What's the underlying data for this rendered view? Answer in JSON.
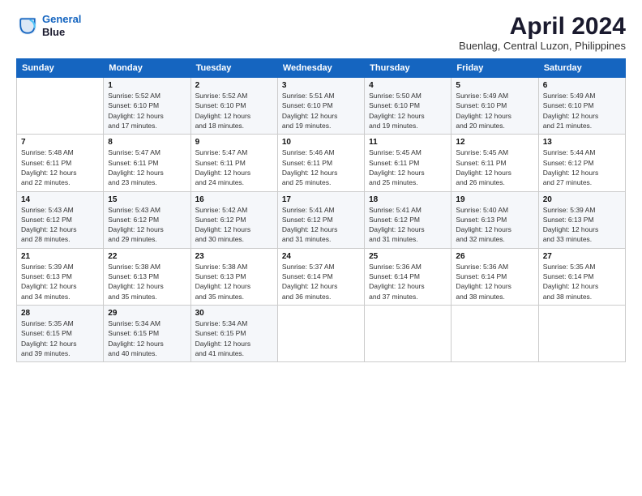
{
  "logo": {
    "line1": "General",
    "line2": "Blue"
  },
  "title": "April 2024",
  "subtitle": "Buenlag, Central Luzon, Philippines",
  "weekdays": [
    "Sunday",
    "Monday",
    "Tuesday",
    "Wednesday",
    "Thursday",
    "Friday",
    "Saturday"
  ],
  "weeks": [
    [
      {
        "day": "",
        "info": ""
      },
      {
        "day": "1",
        "info": "Sunrise: 5:52 AM\nSunset: 6:10 PM\nDaylight: 12 hours\nand 17 minutes."
      },
      {
        "day": "2",
        "info": "Sunrise: 5:52 AM\nSunset: 6:10 PM\nDaylight: 12 hours\nand 18 minutes."
      },
      {
        "day": "3",
        "info": "Sunrise: 5:51 AM\nSunset: 6:10 PM\nDaylight: 12 hours\nand 19 minutes."
      },
      {
        "day": "4",
        "info": "Sunrise: 5:50 AM\nSunset: 6:10 PM\nDaylight: 12 hours\nand 19 minutes."
      },
      {
        "day": "5",
        "info": "Sunrise: 5:49 AM\nSunset: 6:10 PM\nDaylight: 12 hours\nand 20 minutes."
      },
      {
        "day": "6",
        "info": "Sunrise: 5:49 AM\nSunset: 6:10 PM\nDaylight: 12 hours\nand 21 minutes."
      }
    ],
    [
      {
        "day": "7",
        "info": "Sunrise: 5:48 AM\nSunset: 6:11 PM\nDaylight: 12 hours\nand 22 minutes."
      },
      {
        "day": "8",
        "info": "Sunrise: 5:47 AM\nSunset: 6:11 PM\nDaylight: 12 hours\nand 23 minutes."
      },
      {
        "day": "9",
        "info": "Sunrise: 5:47 AM\nSunset: 6:11 PM\nDaylight: 12 hours\nand 24 minutes."
      },
      {
        "day": "10",
        "info": "Sunrise: 5:46 AM\nSunset: 6:11 PM\nDaylight: 12 hours\nand 25 minutes."
      },
      {
        "day": "11",
        "info": "Sunrise: 5:45 AM\nSunset: 6:11 PM\nDaylight: 12 hours\nand 25 minutes."
      },
      {
        "day": "12",
        "info": "Sunrise: 5:45 AM\nSunset: 6:11 PM\nDaylight: 12 hours\nand 26 minutes."
      },
      {
        "day": "13",
        "info": "Sunrise: 5:44 AM\nSunset: 6:12 PM\nDaylight: 12 hours\nand 27 minutes."
      }
    ],
    [
      {
        "day": "14",
        "info": "Sunrise: 5:43 AM\nSunset: 6:12 PM\nDaylight: 12 hours\nand 28 minutes."
      },
      {
        "day": "15",
        "info": "Sunrise: 5:43 AM\nSunset: 6:12 PM\nDaylight: 12 hours\nand 29 minutes."
      },
      {
        "day": "16",
        "info": "Sunrise: 5:42 AM\nSunset: 6:12 PM\nDaylight: 12 hours\nand 30 minutes."
      },
      {
        "day": "17",
        "info": "Sunrise: 5:41 AM\nSunset: 6:12 PM\nDaylight: 12 hours\nand 31 minutes."
      },
      {
        "day": "18",
        "info": "Sunrise: 5:41 AM\nSunset: 6:12 PM\nDaylight: 12 hours\nand 31 minutes."
      },
      {
        "day": "19",
        "info": "Sunrise: 5:40 AM\nSunset: 6:13 PM\nDaylight: 12 hours\nand 32 minutes."
      },
      {
        "day": "20",
        "info": "Sunrise: 5:39 AM\nSunset: 6:13 PM\nDaylight: 12 hours\nand 33 minutes."
      }
    ],
    [
      {
        "day": "21",
        "info": "Sunrise: 5:39 AM\nSunset: 6:13 PM\nDaylight: 12 hours\nand 34 minutes."
      },
      {
        "day": "22",
        "info": "Sunrise: 5:38 AM\nSunset: 6:13 PM\nDaylight: 12 hours\nand 35 minutes."
      },
      {
        "day": "23",
        "info": "Sunrise: 5:38 AM\nSunset: 6:13 PM\nDaylight: 12 hours\nand 35 minutes."
      },
      {
        "day": "24",
        "info": "Sunrise: 5:37 AM\nSunset: 6:14 PM\nDaylight: 12 hours\nand 36 minutes."
      },
      {
        "day": "25",
        "info": "Sunrise: 5:36 AM\nSunset: 6:14 PM\nDaylight: 12 hours\nand 37 minutes."
      },
      {
        "day": "26",
        "info": "Sunrise: 5:36 AM\nSunset: 6:14 PM\nDaylight: 12 hours\nand 38 minutes."
      },
      {
        "day": "27",
        "info": "Sunrise: 5:35 AM\nSunset: 6:14 PM\nDaylight: 12 hours\nand 38 minutes."
      }
    ],
    [
      {
        "day": "28",
        "info": "Sunrise: 5:35 AM\nSunset: 6:15 PM\nDaylight: 12 hours\nand 39 minutes."
      },
      {
        "day": "29",
        "info": "Sunrise: 5:34 AM\nSunset: 6:15 PM\nDaylight: 12 hours\nand 40 minutes."
      },
      {
        "day": "30",
        "info": "Sunrise: 5:34 AM\nSunset: 6:15 PM\nDaylight: 12 hours\nand 41 minutes."
      },
      {
        "day": "",
        "info": ""
      },
      {
        "day": "",
        "info": ""
      },
      {
        "day": "",
        "info": ""
      },
      {
        "day": "",
        "info": ""
      }
    ]
  ]
}
